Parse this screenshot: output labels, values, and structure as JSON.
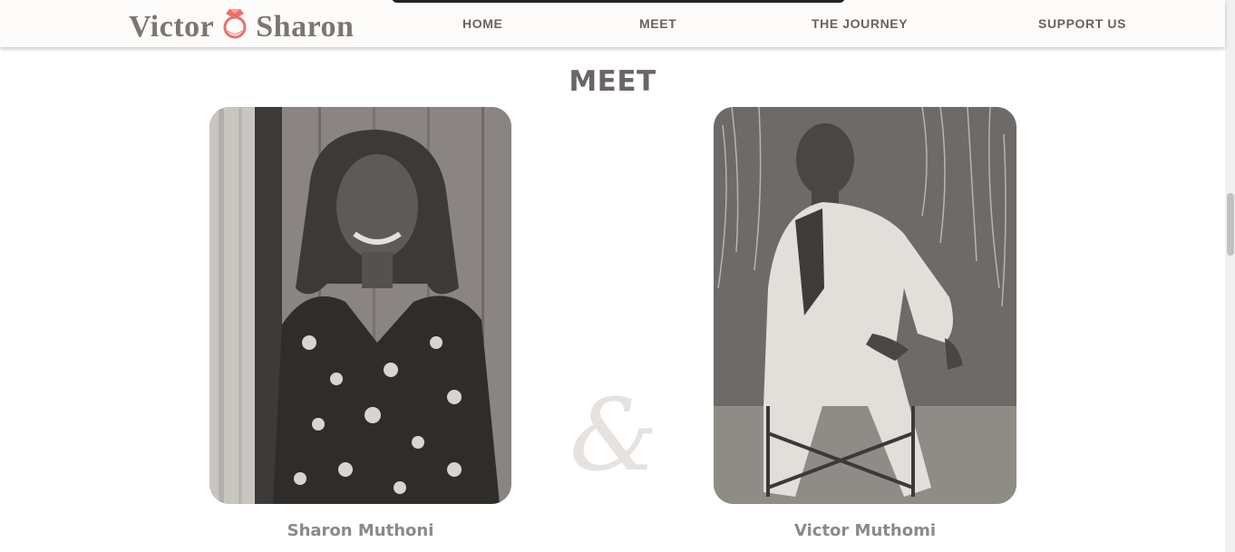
{
  "header": {
    "brand_left": "Victor",
    "brand_right": "Sharon",
    "brand_icon": "ring-icon",
    "brand_color": "#7a7773",
    "accent_color": "#e8706d",
    "nav": [
      "HOME",
      "MEET",
      "THE JOURNEY",
      "SUPPORT US"
    ]
  },
  "section": {
    "title": "MEET",
    "separator": "&",
    "people": [
      {
        "name": "Sharon Muthoni"
      },
      {
        "name": "Victor Muthomi"
      }
    ]
  }
}
